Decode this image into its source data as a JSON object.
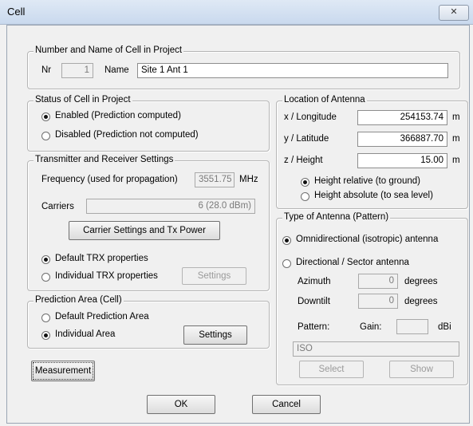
{
  "window": {
    "title": "Cell",
    "close_glyph": "✕"
  },
  "name_group": {
    "legend": "Number and Name of Cell in Project",
    "nr_label": "Nr",
    "nr_value": "1",
    "name_label": "Name",
    "name_value": "Site 1 Ant  1"
  },
  "status_group": {
    "legend": "Status of Cell in Project",
    "enabled_label": "Enabled (Prediction computed)",
    "disabled_label": "Disabled (Prediction not computed)",
    "selected": "enabled"
  },
  "trx_group": {
    "legend": "Transmitter and Receiver Settings",
    "frequency_label": "Frequency (used for propagation)",
    "frequency_value": "3551.75",
    "frequency_unit": "MHz",
    "carriers_label": "Carriers",
    "carriers_value": "6 (28.0 dBm)",
    "carrier_button": "Carrier Settings and Tx Power",
    "default_trx_label": "Default TRX properties",
    "individual_trx_label": "Individual TRX properties",
    "trx_settings_button": "Settings",
    "selected": "default"
  },
  "prediction_group": {
    "legend": "Prediction Area (Cell)",
    "default_label": "Default Prediction Area",
    "individual_label": "Individual Area",
    "settings_button": "Settings",
    "selected": "individual"
  },
  "measurement_button": "Measurement",
  "location_group": {
    "legend": "Location of Antenna",
    "x_label": "x / Longitude",
    "x_value": "254153.74",
    "y_label": "y / Latitude",
    "y_value": "366887.70",
    "z_label": "z / Height",
    "z_value": "15.00",
    "unit": "m",
    "height_relative_label": "Height relative (to ground)",
    "height_absolute_label": "Height absolute (to sea level)",
    "selected": "relative"
  },
  "antenna_group": {
    "legend": "Type of Antenna (Pattern)",
    "omni_label": "Omnidirectional (isotropic) antenna",
    "directional_label": "Directional / Sector antenna",
    "azimuth_label": "Azimuth",
    "azimuth_value": "0",
    "downtilt_label": "Downtilt",
    "downtilt_value": "0",
    "degrees_unit": "degrees",
    "pattern_label": "Pattern:",
    "gain_label": "Gain:",
    "gain_value": "",
    "gain_unit": "dBi",
    "pattern_value": "ISO",
    "select_button": "Select",
    "show_button": "Show",
    "selected": "omni"
  },
  "footer": {
    "ok_button": "OK",
    "cancel_button": "Cancel"
  }
}
